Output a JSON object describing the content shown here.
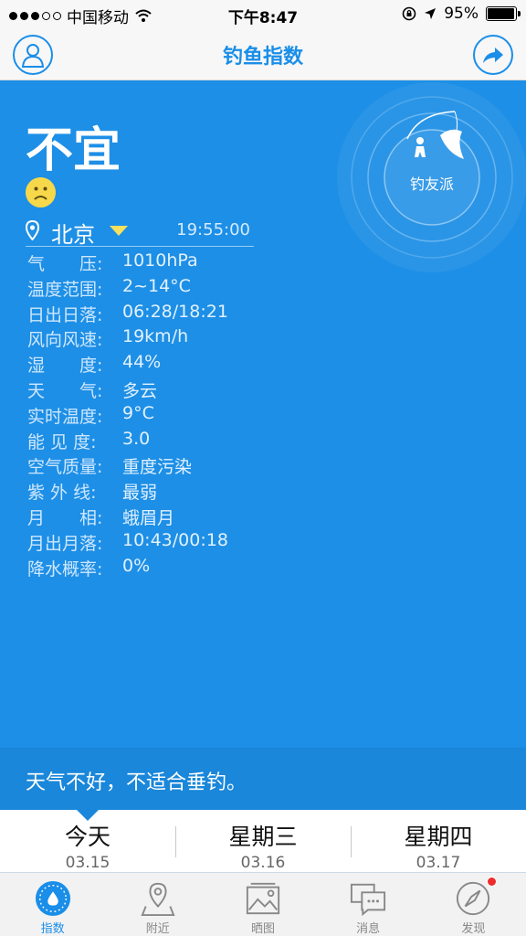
{
  "status_bar": {
    "carrier": "中国移动",
    "time": "下午8:47",
    "battery_percent": "95%",
    "battery_level": 0.95,
    "icons": [
      "wifi-icon",
      "lock-rotation-icon",
      "location-arrow-icon",
      "battery-icon"
    ]
  },
  "nav": {
    "title": "钓鱼指数",
    "left_icon": "user-icon",
    "right_icon": "share-icon"
  },
  "main": {
    "verdict": "不宜",
    "mood_icon": "sad-face-icon",
    "city": "北京",
    "update_time": "19:55:00",
    "brand_name": "钓友派",
    "rows": [
      {
        "label": "气　　压:",
        "value": "1010hPa"
      },
      {
        "label": "温度范围:",
        "value": "2~14°C"
      },
      {
        "label": "日出日落:",
        "value": "06:28/18:21"
      },
      {
        "label": "风向风速:",
        "value": "19km/h"
      },
      {
        "label": "湿　　度:",
        "value": "44%"
      },
      {
        "label": "天　　气:",
        "value": "多云"
      },
      {
        "label": "实时温度:",
        "value": "9°C"
      },
      {
        "label": "能 见 度:",
        "value": "3.0"
      },
      {
        "label": "空气质量:",
        "value": "重度污染"
      },
      {
        "label": "紫 外 线:",
        "value": "最弱"
      },
      {
        "label": "月　　相:",
        "value": "蛾眉月"
      },
      {
        "label": "月出月落:",
        "value": "10:43/00:18"
      },
      {
        "label": "降水概率:",
        "value": "0%"
      }
    ]
  },
  "tip": "天气不好，不适合垂钓。",
  "days": [
    {
      "name": "今天",
      "date": "03.15"
    },
    {
      "name": "星期三",
      "date": "03.16"
    },
    {
      "name": "星期四",
      "date": "03.17"
    }
  ],
  "tabs": [
    {
      "label": "指数",
      "icon": "index-drop-icon",
      "active": true
    },
    {
      "label": "附近",
      "icon": "map-pin-icon",
      "active": false
    },
    {
      "label": "晒图",
      "icon": "photo-icon",
      "active": false
    },
    {
      "label": "消息",
      "icon": "message-icon",
      "active": false
    },
    {
      "label": "发现",
      "icon": "compass-icon",
      "active": false,
      "badge": true
    }
  ],
  "colors": {
    "accent": "#1a8ee8",
    "panel": "#1d8fe6",
    "strip": "#1a87da",
    "badge": "#ee2b2b"
  }
}
